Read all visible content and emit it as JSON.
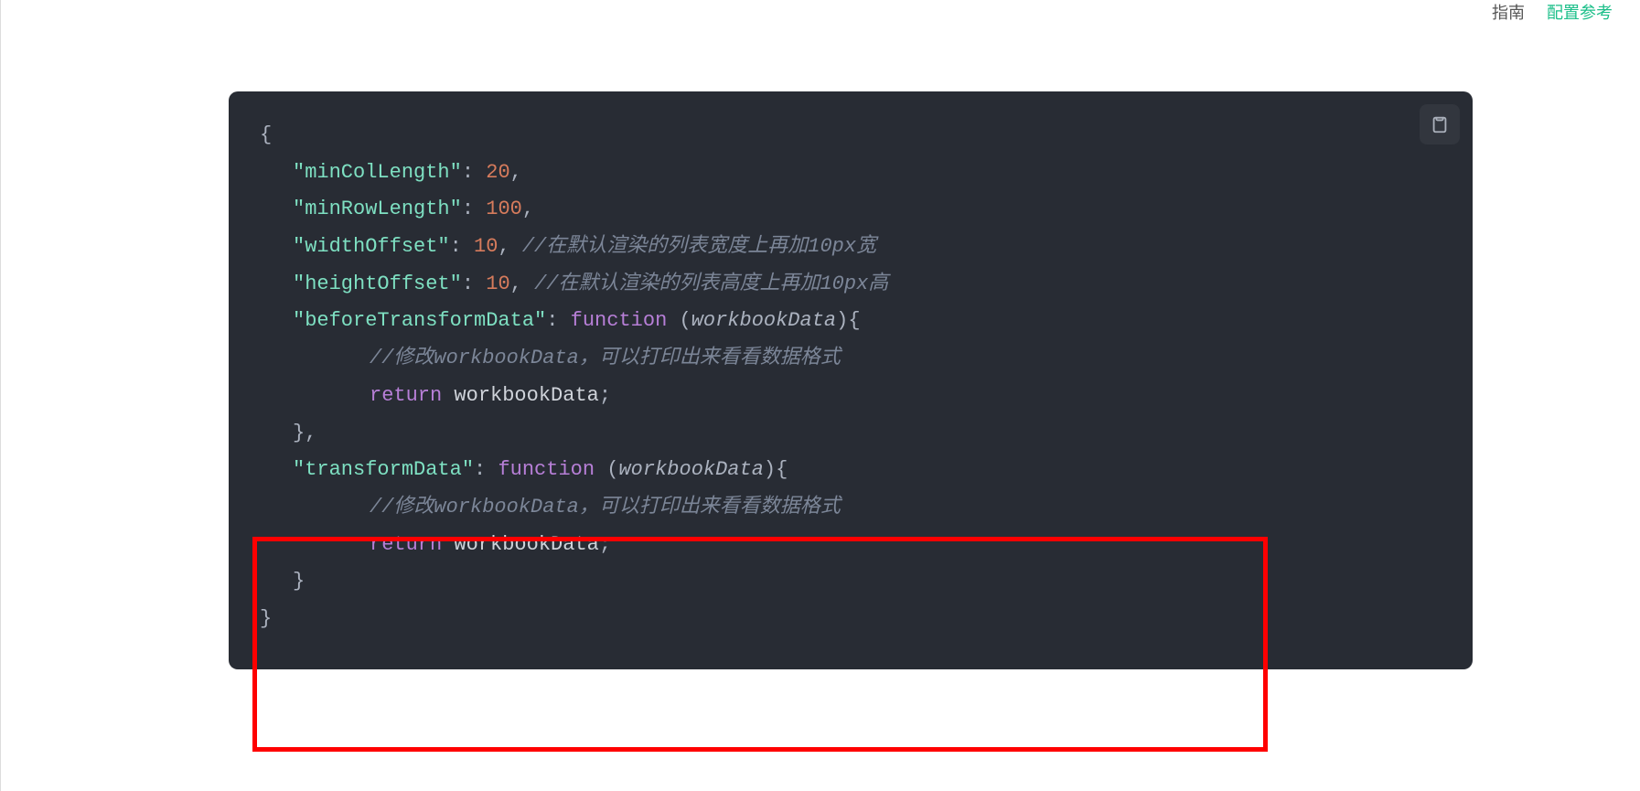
{
  "nav": {
    "item1": "指南",
    "item2": "配置参考"
  },
  "code": {
    "l1": "{",
    "l2_key": "\"minColLength\"",
    "l2_val": "20",
    "l3_key": "\"minRowLength\"",
    "l3_val": "100",
    "l4_key": "\"widthOffset\"",
    "l4_val": "10",
    "l4_comment": "//在默认渲染的列表宽度上再加10px宽",
    "l5_key": "\"heightOffset\"",
    "l5_val": "10",
    "l5_comment": "//在默认渲染的列表高度上再加10px高",
    "l6_key": "\"beforeTransformData\"",
    "l6_fn": "function",
    "l6_arg": "workbookData",
    "l7_comment": "//修改workbookData，可以打印出来看看数据格式",
    "l8_ret": "return",
    "l8_id": "workbookData",
    "l10_key": "\"transformData\"",
    "l10_fn": "function",
    "l10_arg": "workbookData",
    "l11_comment": "//修改workbookData，可以打印出来看看数据格式",
    "l12_ret": "return",
    "l12_id": "workbookData"
  }
}
